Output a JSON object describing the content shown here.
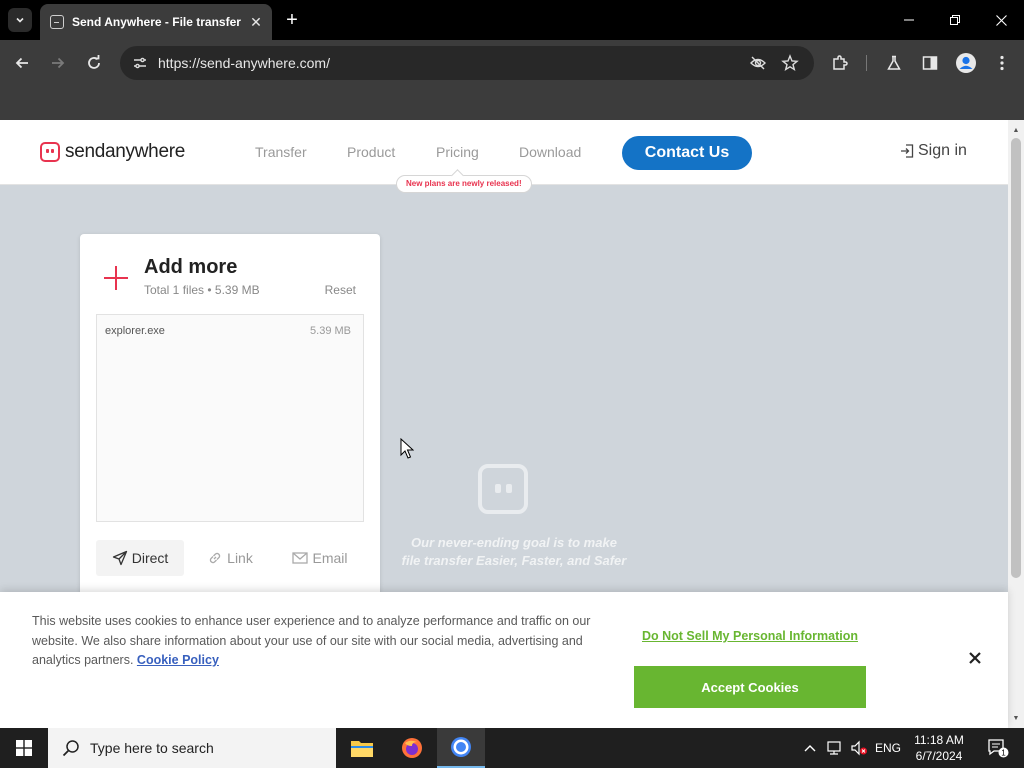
{
  "browser": {
    "tab_title": "Send Anywhere - File transfer",
    "url": "https://send-anywhere.com/"
  },
  "site": {
    "logo_send": "send",
    "logo_anywhere": "anywhere",
    "nav": [
      "Transfer",
      "Product",
      "Pricing",
      "Download"
    ],
    "nav_badge": "New plans are newly released!",
    "contact_label": "Contact Us",
    "signin_label": "Sign in"
  },
  "card": {
    "title": "Add more",
    "subtitle": "Total 1 files • 5.39 MB",
    "reset_label": "Reset",
    "files": [
      {
        "name": "explorer.exe",
        "size": "5.39 MB"
      }
    ],
    "tabs": [
      "Direct",
      "Link",
      "Email"
    ],
    "active_tab": "Direct"
  },
  "hero": {
    "line1": "Our never-ending goal is to make",
    "line2": "file transfer Easier, Faster, and Safer"
  },
  "cookie": {
    "text": "This website uses cookies to enhance user experience and to analyze performance and traffic on our website. We also share information about your use of our site with our social media, advertising and analytics partners.",
    "policy_link": "Cookie Policy",
    "dns_link": "Do Not Sell My Personal Information",
    "accept_label": "Accept Cookies"
  },
  "taskbar": {
    "search_placeholder": "Type here to search",
    "language": "ENG",
    "time": "11:18 AM",
    "date": "6/7/2024",
    "notification_count": "1"
  },
  "colors": {
    "brand_red": "#e8334f",
    "contact_blue": "#1473c6",
    "cookie_green": "#68b631",
    "link_blue": "#3860be"
  }
}
